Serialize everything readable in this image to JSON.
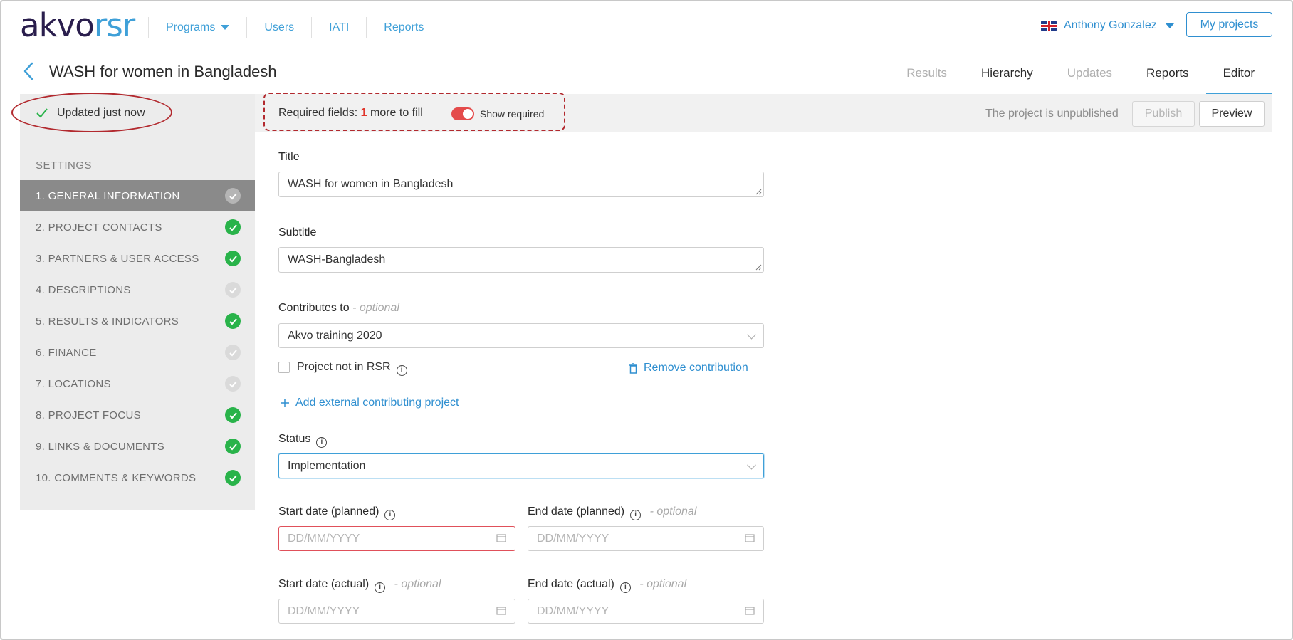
{
  "logo": {
    "part1": "akvo",
    "part2": "rsr"
  },
  "nav": {
    "programs": "Programs",
    "users": "Users",
    "iati": "IATI",
    "reports": "Reports"
  },
  "user": {
    "name": "Anthony Gonzalez",
    "my_projects": "My projects"
  },
  "project": {
    "title": "WASH for women in Bangladesh"
  },
  "tabs": {
    "results": "Results",
    "hierarchy": "Hierarchy",
    "updates": "Updates",
    "reports": "Reports",
    "editor": "Editor"
  },
  "status_bar": {
    "saved": "Updated just now",
    "required_prefix": "Required fields:",
    "required_count": "1",
    "required_suffix": "more to fill",
    "show_required": "Show required",
    "unpublished": "The project is unpublished",
    "publish": "Publish",
    "preview": "Preview"
  },
  "sidebar": {
    "heading": "SETTINGS",
    "items": [
      {
        "label": "1. GENERAL INFORMATION",
        "state": "active"
      },
      {
        "label": "2. PROJECT CONTACTS",
        "state": "done"
      },
      {
        "label": "3. PARTNERS & USER ACCESS",
        "state": "done"
      },
      {
        "label": "4. DESCRIPTIONS",
        "state": "todo"
      },
      {
        "label": "5. RESULTS & INDICATORS",
        "state": "done"
      },
      {
        "label": "6. FINANCE",
        "state": "todo"
      },
      {
        "label": "7. LOCATIONS",
        "state": "todo"
      },
      {
        "label": "8. PROJECT FOCUS",
        "state": "done"
      },
      {
        "label": "9. LINKS & DOCUMENTS",
        "state": "done"
      },
      {
        "label": "10. COMMENTS & KEYWORDS",
        "state": "done"
      }
    ]
  },
  "form": {
    "title_label": "Title",
    "title_value": "WASH for women in Bangladesh",
    "subtitle_label": "Subtitle",
    "subtitle_value": "WASH-Bangladesh",
    "contributes_label": "Contributes to",
    "optional": "- optional",
    "contributes_value": "Akvo training 2020",
    "not_in_rsr": "Project not in RSR",
    "remove_contribution": "Remove contribution",
    "add_external": "Add external contributing project",
    "status_label": "Status",
    "status_value": "Implementation",
    "start_planned_label": "Start date (planned)",
    "end_planned_label": "End date (planned)",
    "start_actual_label": "Start date (actual)",
    "end_actual_label": "End date (actual)",
    "date_placeholder": "DD/MM/YYYY"
  },
  "colors": {
    "brand_dark": "#2a1e4d",
    "brand_blue": "#3fa0d8",
    "success_green": "#29b34a",
    "alert_red": "#e0352b"
  }
}
